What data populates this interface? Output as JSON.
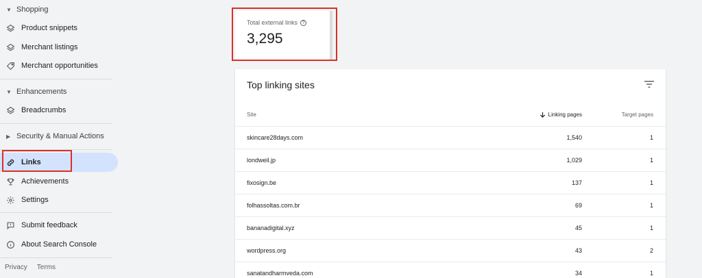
{
  "sidebar": {
    "shopping_header": "Shopping",
    "product_snippets": "Product snippets",
    "merchant_listings": "Merchant listings",
    "merchant_opportunities": "Merchant opportunities",
    "enhancements_header": "Enhancements",
    "breadcrumbs": "Breadcrumbs",
    "security_header": "Security & Manual Actions",
    "links": "Links",
    "achievements": "Achievements",
    "settings": "Settings",
    "submit_feedback": "Submit feedback",
    "about": "About Search Console",
    "footer_privacy": "Privacy",
    "footer_terms": "Terms"
  },
  "metric": {
    "label": "Total external links",
    "value": "3,295"
  },
  "table": {
    "title": "Top linking sites",
    "headers": {
      "site": "Site",
      "linking_pages": "Linking pages",
      "target_pages": "Target pages"
    },
    "rows": [
      {
        "site": "skincare28days.com",
        "linking": "1,540",
        "target": "1"
      },
      {
        "site": "londweil.jp",
        "linking": "1,029",
        "target": "1"
      },
      {
        "site": "fixosign.be",
        "linking": "137",
        "target": "1"
      },
      {
        "site": "folhassoltas.com.br",
        "linking": "69",
        "target": "1"
      },
      {
        "site": "bananadigital.xyz",
        "linking": "45",
        "target": "1"
      },
      {
        "site": "wordpress.org",
        "linking": "43",
        "target": "2"
      },
      {
        "site": "sanatandharmveda.com",
        "linking": "34",
        "target": "1"
      }
    ]
  },
  "colors": {
    "accent": "#d3e3fd",
    "highlight": "#d93025",
    "background": "#f1f3f4"
  }
}
